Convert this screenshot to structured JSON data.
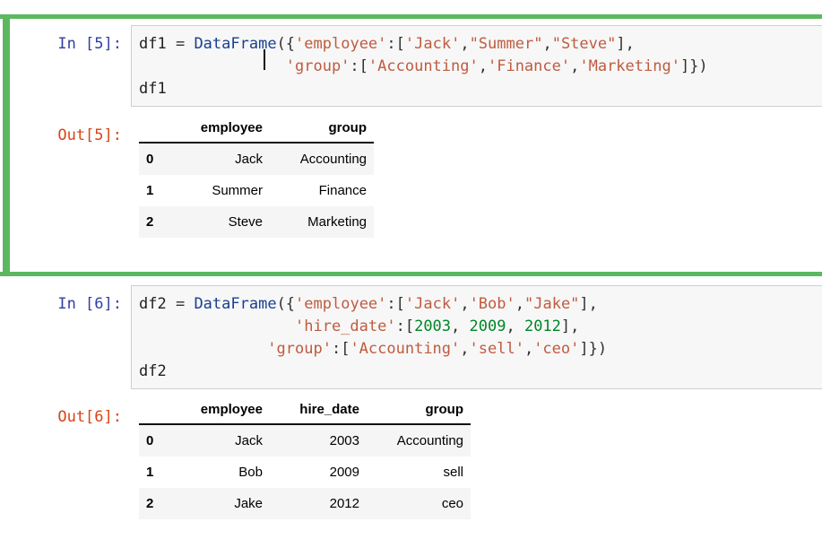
{
  "cells": [
    {
      "id": "cell-1",
      "selected": true,
      "input_prompt": "In [5]:",
      "output_prompt": "Out[5]:",
      "code_lines": [
        [
          {
            "t": "df1 ",
            "c": "name"
          },
          {
            "t": "= ",
            "c": "op"
          },
          {
            "t": "DataFrame",
            "c": "bi"
          },
          {
            "t": "({",
            "c": "punc"
          },
          {
            "t": "'employee'",
            "c": "str"
          },
          {
            "t": ":[",
            "c": "punc"
          },
          {
            "t": "'Jack'",
            "c": "str"
          },
          {
            "t": ",",
            "c": "punc"
          },
          {
            "t": "\"Summer\"",
            "c": "str"
          },
          {
            "t": ",",
            "c": "punc"
          },
          {
            "t": "\"Steve\"",
            "c": "str"
          },
          {
            "t": "],",
            "c": "punc"
          }
        ],
        [
          {
            "t": "                ",
            "c": "name"
          },
          {
            "t": "'group'",
            "c": "str"
          },
          {
            "t": ":[",
            "c": "punc"
          },
          {
            "t": "'Accounting'",
            "c": "str"
          },
          {
            "t": ",",
            "c": "punc"
          },
          {
            "t": "'Finance'",
            "c": "str"
          },
          {
            "t": ",",
            "c": "punc"
          },
          {
            "t": "'Marketing'",
            "c": "str"
          },
          {
            "t": "]})",
            "c": "punc"
          }
        ],
        [
          {
            "t": "df1",
            "c": "name"
          }
        ]
      ],
      "cursor_visible": true,
      "table": {
        "index_header": "",
        "columns": [
          "employee",
          "group"
        ],
        "index": [
          "0",
          "1",
          "2"
        ],
        "rows": [
          [
            "Jack",
            "Accounting"
          ],
          [
            "Summer",
            "Finance"
          ],
          [
            "Steve",
            "Marketing"
          ]
        ]
      }
    },
    {
      "id": "cell-2",
      "selected": false,
      "input_prompt": "In [6]:",
      "output_prompt": "Out[6]:",
      "code_lines": [
        [
          {
            "t": "df2 ",
            "c": "name"
          },
          {
            "t": "= ",
            "c": "op"
          },
          {
            "t": "DataFrame",
            "c": "bi"
          },
          {
            "t": "({",
            "c": "punc"
          },
          {
            "t": "'employee'",
            "c": "str"
          },
          {
            "t": ":[",
            "c": "punc"
          },
          {
            "t": "'Jack'",
            "c": "str"
          },
          {
            "t": ",",
            "c": "punc"
          },
          {
            "t": "'Bob'",
            "c": "str"
          },
          {
            "t": ",",
            "c": "punc"
          },
          {
            "t": "\"Jake\"",
            "c": "str"
          },
          {
            "t": "],",
            "c": "punc"
          }
        ],
        [
          {
            "t": "                 ",
            "c": "name"
          },
          {
            "t": "'hire_date'",
            "c": "str"
          },
          {
            "t": ":[",
            "c": "punc"
          },
          {
            "t": "2003",
            "c": "num"
          },
          {
            "t": ", ",
            "c": "punc"
          },
          {
            "t": "2009",
            "c": "num"
          },
          {
            "t": ", ",
            "c": "punc"
          },
          {
            "t": "2012",
            "c": "num"
          },
          {
            "t": "],",
            "c": "punc"
          }
        ],
        [
          {
            "t": "              ",
            "c": "name"
          },
          {
            "t": "'group'",
            "c": "str"
          },
          {
            "t": ":[",
            "c": "punc"
          },
          {
            "t": "'Accounting'",
            "c": "str"
          },
          {
            "t": ",",
            "c": "punc"
          },
          {
            "t": "'sell'",
            "c": "str"
          },
          {
            "t": ",",
            "c": "punc"
          },
          {
            "t": "'ceo'",
            "c": "str"
          },
          {
            "t": "]})",
            "c": "punc"
          }
        ],
        [
          {
            "t": "df2",
            "c": "name"
          }
        ]
      ],
      "cursor_visible": false,
      "table": {
        "index_header": "",
        "columns": [
          "employee",
          "hire_date",
          "group"
        ],
        "index": [
          "0",
          "1",
          "2"
        ],
        "rows": [
          [
            "Jack",
            "2003",
            "Accounting"
          ],
          [
            "Bob",
            "2009",
            "sell"
          ],
          [
            "Jake",
            "2012",
            "ceo"
          ]
        ]
      }
    }
  ],
  "colors": {
    "selected_cell_accent": "#5cb860",
    "input_prompt": "#303f9f",
    "output_prompt": "#d84315",
    "code_background": "#f7f7f7",
    "code_border": "#cfcfcf",
    "string_literal": "#bf5b3f",
    "number_literal": "#00852a",
    "builtin_name": "#1a3f8f",
    "table_stripe": "#f5f5f5"
  }
}
